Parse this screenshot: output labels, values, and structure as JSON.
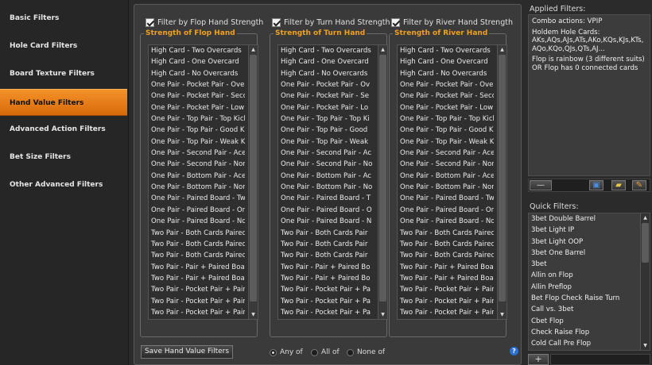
{
  "sidebar": {
    "items": [
      {
        "label": "Basic Filters",
        "active": false
      },
      {
        "label": "Hole Card Filters",
        "active": false
      },
      {
        "label": "Board Texture Filters",
        "active": false
      },
      {
        "label": "Hand Value Filters",
        "active": true
      },
      {
        "label": "Advanced Action Filters",
        "active": false
      },
      {
        "label": "Bet Size Filters",
        "active": false
      },
      {
        "label": "Other Advanced Filters",
        "active": false
      }
    ]
  },
  "flop": {
    "checkbox_label": "Filter by Flop Hand Strength",
    "checked": true,
    "group_title": "Strength of Flop Hand",
    "items": [
      "High Card - Two Overcards",
      "High Card - One Overcard",
      "High Card - No Overcards",
      "One Pair - Pocket Pair - Overp",
      "One Pair - Pocket Pair - Secon",
      "One Pair - Pocket Pair - Low P",
      "One Pair - Top Pair - Top Kicke",
      "One Pair - Top Pair - Good Kic",
      "One Pair - Top Pair - Weak Kic",
      "One Pair - Second Pair - Ace K",
      "One Pair - Second Pair - Non A",
      "One Pair - Bottom Pair - Ace K",
      "One Pair - Bottom Pair - Non A",
      "One Pair - Paired Board - Two",
      "One Pair - Paired Board - One",
      "One Pair - Paired Board - No O",
      "Two Pair - Both Cards Paired -",
      "Two Pair - Both Cards Paired -",
      "Two Pair - Both Cards Paired -",
      "Two Pair - Pair + Paired Board",
      "Two Pair - Pair + Paired Board",
      "Two Pair - Pocket Pair + Paired",
      "Two Pair - Pocket Pair + Paired",
      "Two Pair - Pocket Pair + Paired"
    ]
  },
  "turn": {
    "checkbox_label": "Filter by Turn Hand Strength",
    "checked": true,
    "group_title": "Strength of Turn Hand",
    "items": [
      "High Card - Two Overcards",
      "High Card - One Overcard",
      "High Card - No Overcards",
      "One Pair - Pocket Pair - Ov",
      "One Pair - Pocket Pair - Se",
      "One Pair - Pocket Pair - Lo",
      "One Pair - Top Pair - Top Ki",
      "One Pair - Top Pair - Good",
      "One Pair - Top Pair - Weak",
      "One Pair - Second Pair - Ac",
      "One Pair - Second Pair - No",
      "One Pair - Bottom Pair - Ac",
      "One Pair - Bottom Pair - No",
      "One Pair - Paired Board - T",
      "One Pair - Paired Board - O",
      "One Pair - Paired Board - N",
      "Two Pair - Both Cards Pair",
      "Two Pair - Both Cards Pair",
      "Two Pair - Both Cards Pair",
      "Two Pair - Pair + Paired Bo",
      "Two Pair - Pair + Paired Bo",
      "Two Pair - Pocket Pair + Pa",
      "Two Pair - Pocket Pair + Pa",
      "Two Pair - Pocket Pair + Pa"
    ]
  },
  "river": {
    "checkbox_label": "Filter by River Hand Strength",
    "checked": true,
    "group_title": "Strength of River Hand",
    "items": [
      "High Card - Two Overcards",
      "High Card - One Overcard",
      "High Card - No Overcards",
      "One Pair - Pocket Pair - Overp",
      "One Pair - Pocket Pair - Secon",
      "One Pair - Pocket Pair - Low P",
      "One Pair - Top Pair - Top Kicke",
      "One Pair - Top Pair - Good Kic",
      "One Pair - Top Pair - Weak Kic",
      "One Pair - Second Pair - Ace K",
      "One Pair - Second Pair - Non A",
      "One Pair - Bottom Pair - Ace K",
      "One Pair - Bottom Pair - Non A",
      "One Pair - Paired Board - Two",
      "One Pair - Paired Board - One",
      "One Pair - Paired Board - No O",
      "Two Pair - Both Cards Paired -",
      "Two Pair - Both Cards Paired -",
      "Two Pair - Both Cards Paired -",
      "Two Pair - Pair + Paired Board",
      "Two Pair - Pair + Paired Board",
      "Two Pair - Pocket Pair + Paired",
      "Two Pair - Pocket Pair + Paired",
      "Two Pair - Pocket Pair + Paired"
    ]
  },
  "footer": {
    "save_label": "Save Hand Value Filters",
    "radio_any": "Any of",
    "radio_all": "All of",
    "radio_none": "None of",
    "selected": "any",
    "help_label": "?"
  },
  "right": {
    "applied_title": "Applied Filters:",
    "applied_items": [
      "Combo actions: VPIP",
      "Holdem Hole Cards: AKs,AQs,AJs,ATs,AKo,KQs,KJs,KTs,AQo,KQo,QJs,QTs,AJ...",
      "Flop is rainbow (3 different suits) OR Flop has 0 connected cards"
    ],
    "remove_label": "—",
    "quick_title": "Quick Filters:",
    "quick_items": [
      "3bet Double Barrel",
      "3bet Light IP",
      "3bet Light OOP",
      "3bet One Barrel",
      "3bet",
      "Allin on Flop",
      "Allin Preflop",
      "Bet Flop Check Raise Turn",
      "Call vs. 3bet",
      "Cbet Flop",
      "Check Raise Flop",
      "Cold Call Pre Flop"
    ],
    "add_label": "+"
  },
  "colors": {
    "accent": "#e8801a",
    "group_title": "#f0a020"
  }
}
